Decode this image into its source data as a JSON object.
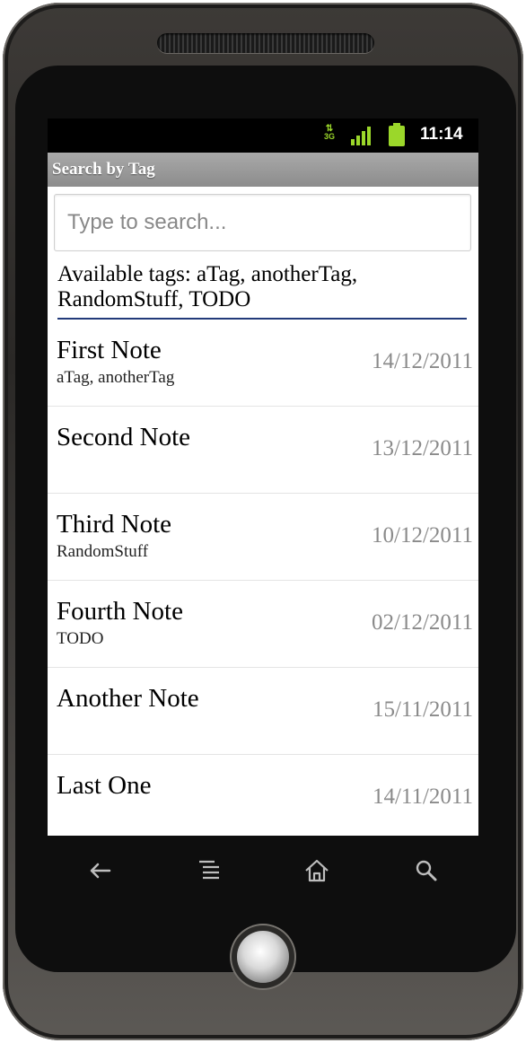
{
  "status_bar": {
    "network": "3G",
    "time": "11:14",
    "accent": "#9bd72a"
  },
  "app": {
    "title": "Search by Tag"
  },
  "search": {
    "placeholder": "Type to search...",
    "value": ""
  },
  "tags": {
    "label": "Available tags: aTag, anotherTag, RandomStuff, TODO"
  },
  "notes": [
    {
      "title": "First Note",
      "tags": "aTag, anotherTag",
      "date": "14/12/2011"
    },
    {
      "title": "Second Note",
      "tags": "",
      "date": "13/12/2011"
    },
    {
      "title": "Third Note",
      "tags": "RandomStuff",
      "date": "10/12/2011"
    },
    {
      "title": "Fourth Note",
      "tags": "TODO",
      "date": "02/12/2011"
    },
    {
      "title": "Another Note",
      "tags": "",
      "date": "15/11/2011"
    },
    {
      "title": "Last One",
      "tags": "",
      "date": "14/11/2011"
    }
  ],
  "soft_keys": [
    "back-icon",
    "menu-icon",
    "home-icon",
    "search-icon"
  ]
}
